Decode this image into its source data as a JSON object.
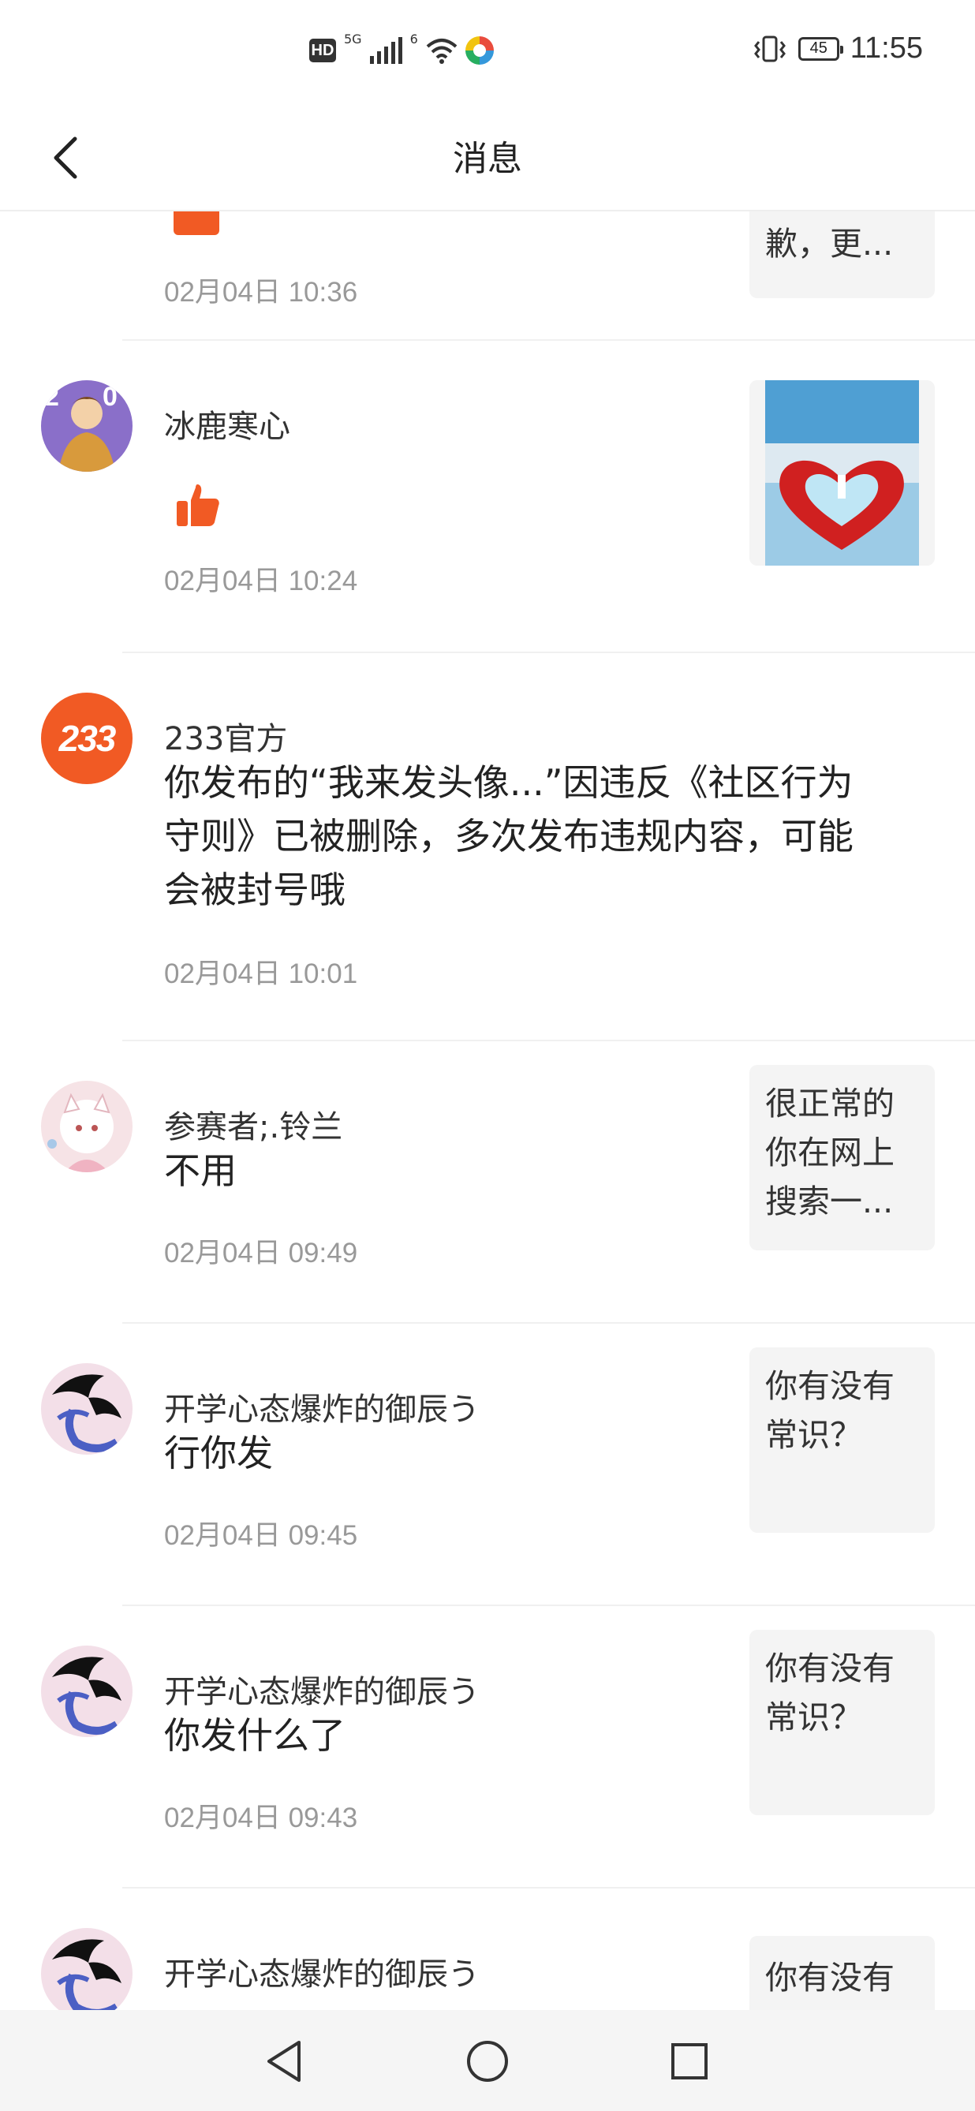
{
  "status_bar": {
    "hd": "HD",
    "network_5g": "5G",
    "network_sub": "1",
    "wifi_sub": "6",
    "battery": "45",
    "time": "11:55"
  },
  "header": {
    "title": "消息"
  },
  "messages": [
    {
      "user": "",
      "text": "",
      "time": "02月04日 10:36",
      "quote": "歉，更..."
    },
    {
      "user": "冰鹿寒心",
      "text": "",
      "time": "02月04日 10:24",
      "quote": ""
    },
    {
      "user": "233官方",
      "avatar_text": "233",
      "text": "你发布的“我来发头像...”因违反《社区行为守则》已被删除，多次发布违规内容，可能会被封号哦",
      "time": "02月04日 10:01",
      "quote": ""
    },
    {
      "user": "参赛者;.铃兰",
      "text": "不用",
      "time": "02月04日 09:49",
      "quote": "很正常的你在网上搜索一..."
    },
    {
      "user": "开学心态爆炸的御辰う",
      "text": "行你发",
      "time": "02月04日 09:45",
      "quote": "你有没有常识？"
    },
    {
      "user": "开学心态爆炸的御辰う",
      "text": "你发什么了",
      "time": "02月04日 09:43",
      "quote": "你有没有常识？"
    },
    {
      "user": "开学心态爆炸的御辰う",
      "text": "",
      "time": "",
      "quote": "你有没有"
    }
  ],
  "icons": {
    "back": "chevron-left-icon",
    "like": "thumbs-up-icon",
    "nav_back": "triangle-back-icon",
    "nav_home": "circle-home-icon",
    "nav_recent": "square-recent-icon"
  },
  "colors": {
    "accent": "#f15a24",
    "time_text": "#999999",
    "quote_bg": "#f4f4f4"
  }
}
